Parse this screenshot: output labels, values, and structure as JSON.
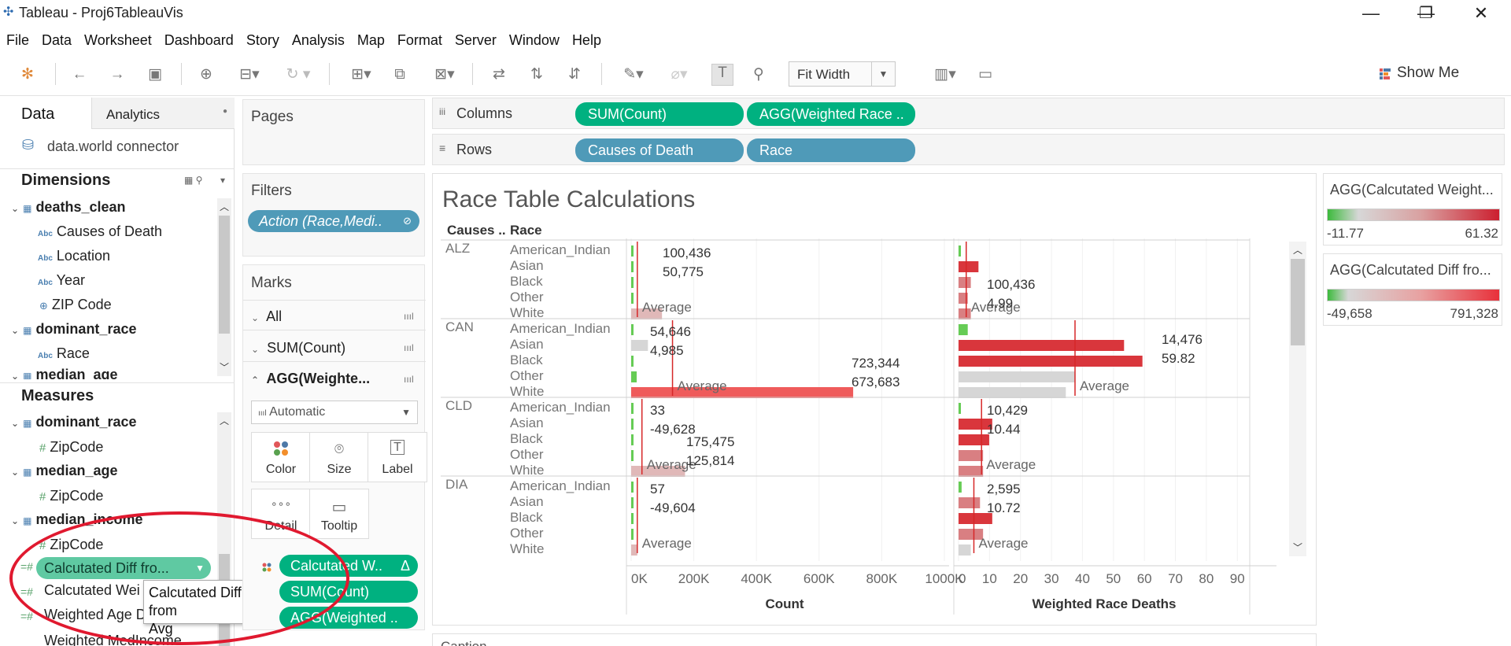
{
  "window": {
    "title": "Tableau - Proj6TableauVis",
    "min": "—",
    "restore": "❐",
    "close": "✕"
  },
  "menu": [
    "File",
    "Data",
    "Worksheet",
    "Dashboard",
    "Story",
    "Analysis",
    "Map",
    "Format",
    "Server",
    "Window",
    "Help"
  ],
  "toolbar": {
    "fit": "Fit Width",
    "show_me": "Show Me"
  },
  "datapane": {
    "tab_data": "Data",
    "tab_analytics": "Analytics",
    "connector": "data.world connector",
    "dimensions_title": "Dimensions",
    "measures_title": "Measures",
    "dimensions": [
      {
        "label": "deaths_clean",
        "kind": "table"
      },
      {
        "label": "Causes of Death",
        "kind": "abc"
      },
      {
        "label": "Location",
        "kind": "abc"
      },
      {
        "label": "Year",
        "kind": "abc"
      },
      {
        "label": "ZIP Code",
        "kind": "geo"
      },
      {
        "label": "dominant_race",
        "kind": "table"
      },
      {
        "label": "Race",
        "kind": "abc"
      },
      {
        "label": "median_age",
        "kind": "table"
      }
    ],
    "measures": [
      {
        "label": "dominant_race",
        "kind": "table"
      },
      {
        "label": "ZipCode",
        "kind": "hash"
      },
      {
        "label": "median_age",
        "kind": "table"
      },
      {
        "label": "ZipCode",
        "kind": "hash"
      },
      {
        "label": "median_income",
        "kind": "table"
      },
      {
        "label": "ZipCode",
        "kind": "hash"
      },
      {
        "label": "Calcutated Diff fro...",
        "kind": "calc-pill"
      },
      {
        "label": "Calcutated Wei",
        "kind": "calc"
      },
      {
        "label": "Weighted Age D",
        "kind": "calc"
      },
      {
        "label": "Weighted MedIncome",
        "kind": "calc"
      }
    ],
    "tooltip_line1": "Calcutated Diff from",
    "tooltip_line2": "Avg"
  },
  "cards": {
    "pages": "Pages",
    "filters": "Filters",
    "filter_pill": "Action (Race,Medi..",
    "marks": "Marks",
    "marks_all": "All",
    "marks_sum": "SUM(Count)",
    "marks_agg": "AGG(Weighte...",
    "mark_type": "Automatic",
    "btn_color": "Color",
    "btn_size": "Size",
    "btn_label": "Label",
    "btn_detail": "Detail",
    "btn_tooltip": "Tooltip",
    "pill_color": "Calcutated W..",
    "pill_sum": "SUM(Count)",
    "pill_agg": "AGG(Weighted ..",
    "delta": "Δ"
  },
  "shelves": {
    "columns_label": "Columns",
    "rows_label": "Rows",
    "col_pills": [
      "SUM(Count)",
      "AGG(Weighted Race .."
    ],
    "row_pills": [
      "Causes of Death",
      "Race"
    ]
  },
  "view": {
    "title": "Race Table Calculations",
    "col_causes": "Causes ..",
    "col_race": "Race",
    "average": "Average",
    "bottom_label": "Caption"
  },
  "chart_data": {
    "type": "bar",
    "title": "Race Table Calculations",
    "races": [
      "American_Indian",
      "Asian",
      "Black",
      "Other",
      "White"
    ],
    "causes": [
      "ALZ",
      "CAN",
      "CLD",
      "DIA"
    ],
    "panes": [
      {
        "xlabel": "Count",
        "ticks": [
          "0K",
          "200K",
          "400K",
          "600K",
          "800K",
          "1000K"
        ],
        "xlim": [
          0,
          1000000
        ],
        "average_lines": {
          "ALZ": 20087,
          "CAN": 134737,
          "CLD": 35163,
          "DIA": 20000
        },
        "values": {
          "ALZ": [
            500,
            1500,
            2500,
            2000,
            100436
          ],
          "CAN": [
            800,
            54646,
            4985,
            18000,
            723344
          ],
          "CLD": [
            33,
            1000,
            3000,
            2000,
            175475
          ],
          "DIA": [
            57,
            400,
            2000,
            1500,
            20000
          ]
        },
        "data_labels": [
          {
            "cause": "ALZ",
            "text": "100,436"
          },
          {
            "cause": "ALZ",
            "text": "50,775"
          },
          {
            "cause": "CAN",
            "text": "54,646"
          },
          {
            "cause": "CAN",
            "text": "4,985"
          },
          {
            "cause": "CAN",
            "text": "723,344"
          },
          {
            "cause": "CAN",
            "text": "673,683"
          },
          {
            "cause": "CLD",
            "text": "33"
          },
          {
            "cause": "CLD",
            "text": "-49,628"
          },
          {
            "cause": "CLD",
            "text": "175,475"
          },
          {
            "cause": "CLD",
            "text": "125,814"
          },
          {
            "cause": "DIA",
            "text": "57"
          },
          {
            "cause": "DIA",
            "text": "-49,604"
          }
        ]
      },
      {
        "xlabel": "Weighted Race Deaths",
        "ticks": [
          "0",
          "10",
          "20",
          "30",
          "40",
          "50",
          "60",
          "70",
          "80",
          "90"
        ],
        "xlim": [
          0,
          95
        ],
        "average_lines": {
          "ALZ": 2.5,
          "CAN": 38,
          "CLD": 7.5,
          "DIA": 5
        },
        "values": {
          "ALZ": [
            0.5,
            6.5,
            4,
            3,
            4
          ],
          "CAN": [
            3,
            54,
            60,
            38,
            35
          ],
          "CLD": [
            0.5,
            11,
            10,
            8,
            8
          ],
          "DIA": [
            1,
            7,
            11,
            8,
            4
          ]
        },
        "data_labels": [
          {
            "cause": "ALZ",
            "text": "100,436"
          },
          {
            "cause": "ALZ",
            "text": "4.99"
          },
          {
            "cause": "CAN",
            "text": "14,476"
          },
          {
            "cause": "CAN",
            "text": "59.82"
          },
          {
            "cause": "CLD",
            "text": "10,429"
          },
          {
            "cause": "CLD",
            "text": "10.44"
          },
          {
            "cause": "DIA",
            "text": "2,595"
          },
          {
            "cause": "DIA",
            "text": "10.72"
          }
        ]
      }
    ],
    "legends": [
      {
        "title": "AGG(Calcutated Weight...",
        "min": "-11.77",
        "max": "61.32"
      },
      {
        "title": "AGG(Calcutated Diff fro...",
        "min": "-49,658",
        "max": "791,328"
      }
    ]
  }
}
